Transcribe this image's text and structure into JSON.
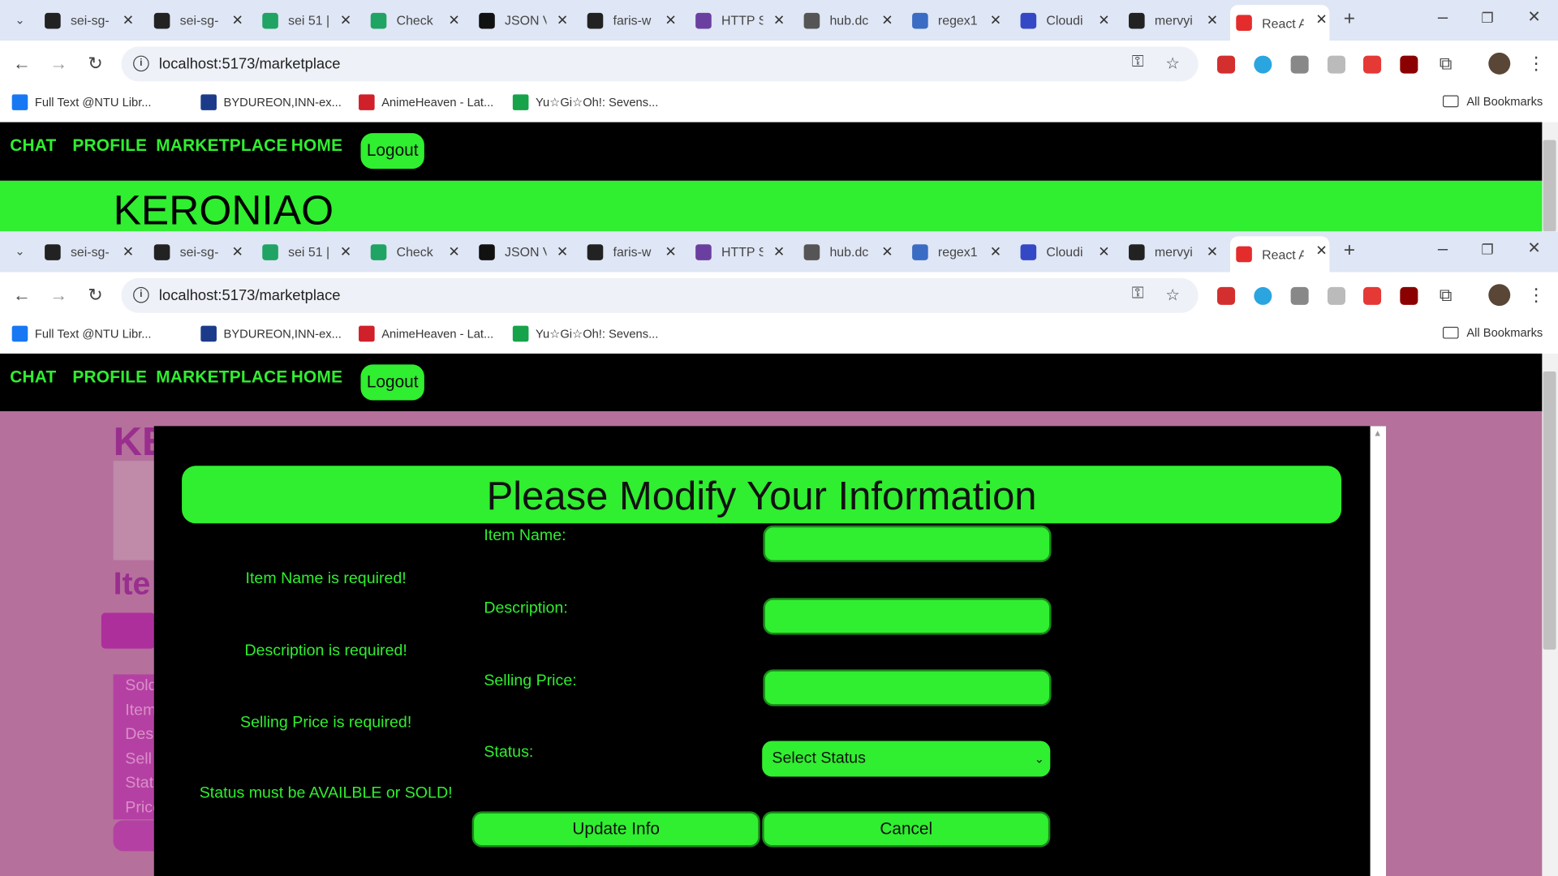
{
  "browser": {
    "tabs": [
      {
        "title": "sei-sg-",
        "icon": "github-icon",
        "color": "#222222"
      },
      {
        "title": "sei-sg-",
        "icon": "github-icon",
        "color": "#222222"
      },
      {
        "title": "sei 51 |",
        "icon": "sheets-icon",
        "color": "#1fa463"
      },
      {
        "title": "Check",
        "icon": "sheets-icon",
        "color": "#1fa463"
      },
      {
        "title": "JSON V",
        "icon": "json-icon",
        "color": "#111111"
      },
      {
        "title": "faris-w",
        "icon": "github-icon",
        "color": "#222222"
      },
      {
        "title": "HTTP S",
        "icon": "http-icon",
        "color": "#6b3fa0"
      },
      {
        "title": "hub.dc",
        "icon": "docker-icon",
        "color": "#555555"
      },
      {
        "title": "regex1",
        "icon": "regex-icon",
        "color": "#3b6cc4"
      },
      {
        "title": "Cloudi",
        "icon": "cloudinary-icon",
        "color": "#3448c5"
      },
      {
        "title": "mervyi",
        "icon": "github-icon",
        "color": "#222222"
      },
      {
        "title": "React A",
        "icon": "react-ga-icon",
        "color": "#e52c2c"
      }
    ],
    "new_tab": "+",
    "url": "localhost:5173/marketplace",
    "bookmarks": [
      {
        "label": "Full Text @NTU Libr...",
        "color": "#1877f2"
      },
      {
        "label": "BYDUREON,INN-ex...",
        "color": "#1b3b8a"
      },
      {
        "label": "AnimeHeaven - Lat...",
        "color": "#d0202a"
      },
      {
        "label": "Yu☆Gi☆Oh!: Sevens...",
        "color": "#16a34a"
      }
    ],
    "all_bookmarks": "All Bookmarks"
  },
  "app": {
    "nav": [
      "CHAT",
      "PROFILE",
      "MARKETPLACE",
      "HOME"
    ],
    "logout": "Logout",
    "brand": "KERONIAO",
    "bg_ke": "KE",
    "bg_ite": "Ite",
    "bg_list": [
      "Sold",
      "Item",
      "Desc",
      "Sell",
      "Stat",
      "Price"
    ]
  },
  "modal": {
    "title": "Please Modify Your Information",
    "fields": [
      {
        "label": "Item Name:",
        "error": "Item Name is required!",
        "value": ""
      },
      {
        "label": "Description:",
        "error": "Description is required!",
        "value": ""
      },
      {
        "label": "Selling Price:",
        "error": "Selling Price is required!",
        "value": ""
      }
    ],
    "status_label": "Status:",
    "status_error": "Status must be AVAILBLE or SOLD!",
    "status_select": "Select Status",
    "update_button": "Update Info",
    "cancel_button": "Cancel"
  },
  "colors": {
    "accent": "#30ee30",
    "overlay": "#b5709c",
    "nav_bg": "#000000"
  }
}
